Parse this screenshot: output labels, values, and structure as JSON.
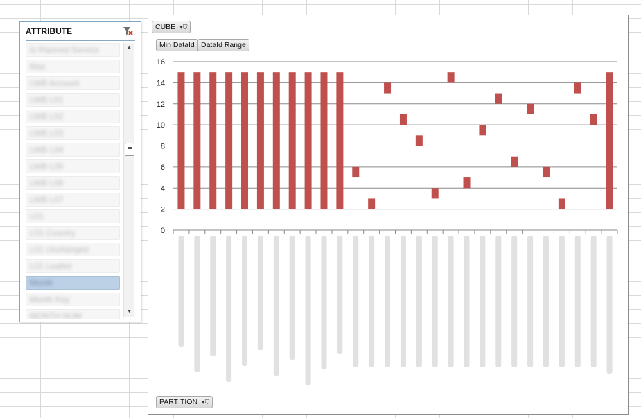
{
  "slicer": {
    "title": "ATTRIBUTE",
    "items": [
      {
        "label": "Is Planned Service"
      },
      {
        "label": "Max"
      },
      {
        "label": "LWB Account"
      },
      {
        "label": "LWB L01"
      },
      {
        "label": "LWB L02"
      },
      {
        "label": "LWB L03"
      },
      {
        "label": "LWB L04"
      },
      {
        "label": "LWB L05"
      },
      {
        "label": "LWB L06"
      },
      {
        "label": "LWB L07"
      },
      {
        "label": "L01"
      },
      {
        "label": "L01 Country"
      },
      {
        "label": "L01 Unchanged"
      },
      {
        "label": "L01 Leafed"
      },
      {
        "label": "Month",
        "selected": true
      },
      {
        "label": "Month Key"
      },
      {
        "label": "MONTH NUM"
      }
    ]
  },
  "pivot": {
    "filter_field": "CUBE",
    "value_fields": [
      "Min DataId",
      "DataId Range"
    ],
    "axis_field": "PARTITION"
  },
  "chart_data": {
    "type": "bar",
    "subtype": "floating-stacked",
    "title": "",
    "xlabel": "",
    "ylabel": "",
    "ylim": [
      0,
      16
    ],
    "yticks": [
      0,
      2,
      4,
      6,
      8,
      10,
      12,
      14,
      16
    ],
    "grid": true,
    "legend": "none",
    "bar_color": "#c0504d",
    "series": [
      {
        "name": "Min DataId",
        "visible": false,
        "values": [
          2,
          2,
          2,
          2,
          2,
          2,
          2,
          2,
          2,
          2,
          2,
          5,
          2,
          13,
          10,
          8,
          3,
          14,
          4,
          9,
          12,
          6,
          11,
          5,
          2,
          13,
          10,
          2
        ]
      },
      {
        "name": "DataId Range",
        "values": [
          13,
          13,
          13,
          13,
          13,
          13,
          13,
          13,
          13,
          13,
          13,
          1,
          1,
          1,
          1,
          1,
          1,
          1,
          1,
          1,
          1,
          1,
          1,
          1,
          1,
          1,
          1,
          13
        ]
      }
    ]
  }
}
